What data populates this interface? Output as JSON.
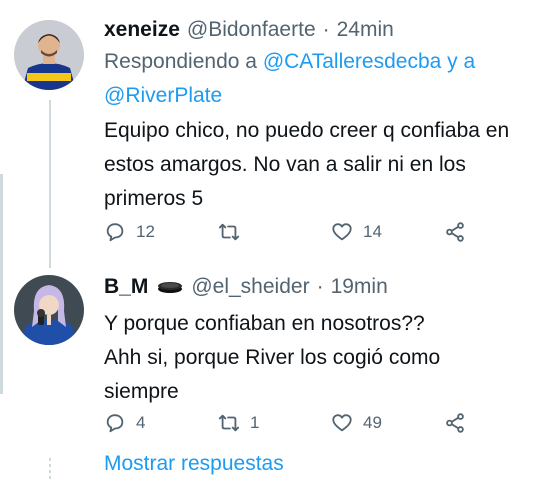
{
  "tweet1": {
    "display_name": "xeneize",
    "handle": "@Bidonfaerte",
    "separator": "·",
    "time": "24min",
    "reply_prefix": "Respondiendo a",
    "mention1": "@CATalleresdecba",
    "reply_and": "y a",
    "mention2": "@RiverPlate",
    "text": "Equipo chico, no puedo creer q confiaba en estos amargos. No van a salir ni en los primeros 5",
    "reply_count": "12",
    "retweet_count": "",
    "like_count": "14"
  },
  "tweet2": {
    "display_name": "B_M",
    "handle": "@el_sheider",
    "separator": "·",
    "time": "19min",
    "text_line1": "Y porque confiaban en nosotros??",
    "text_line2": "Ahh si, porque River los cogió como",
    "text_line3": "siempre",
    "reply_count": "4",
    "retweet_count": "1",
    "like_count": "49"
  },
  "show_replies_label": "Mostrar respuestas",
  "colors": {
    "accent": "#1d9bf0",
    "muted": "#536471",
    "text": "#0f1419",
    "line": "#cfd9de"
  },
  "icons": [
    "reply-icon",
    "retweet-icon",
    "like-icon",
    "share-icon",
    "hockey-puck-emoji-icon"
  ]
}
